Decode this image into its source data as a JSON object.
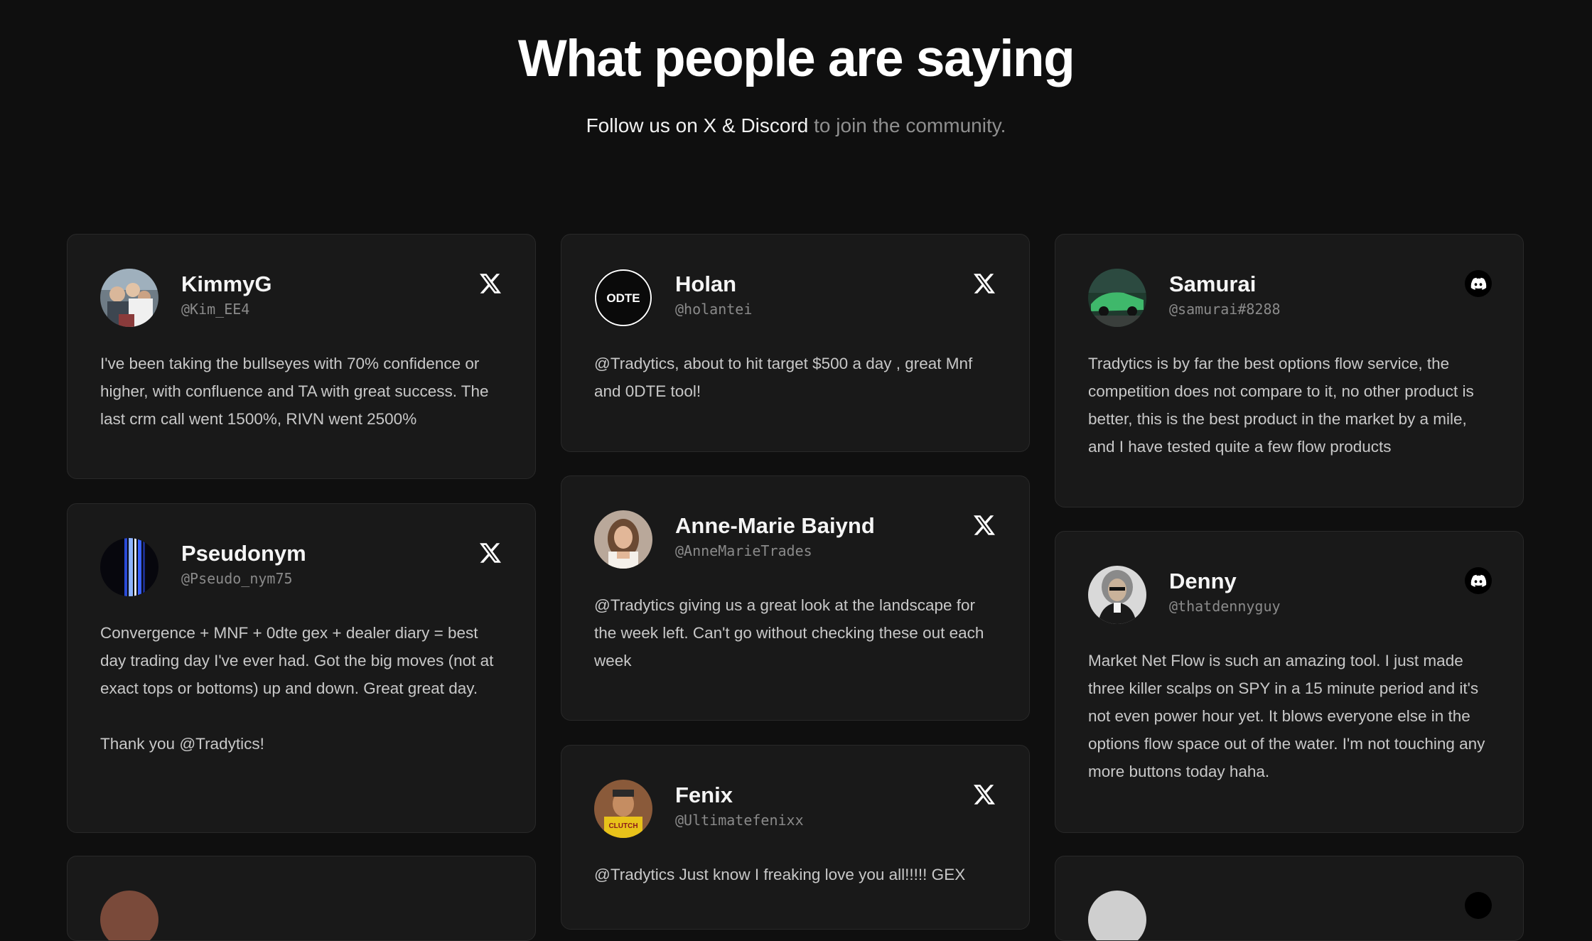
{
  "header": {
    "title": "What people are saying",
    "subtitle_strong": "Follow us on X & Discord",
    "subtitle_muted": " to join the community."
  },
  "colors": {
    "background": "#0f0f0f",
    "card_background": "#191919",
    "card_border": "#292929",
    "handle_text": "#8a8a8a",
    "body_text": "#c8c8c8",
    "muted_text": "#8f8f8f"
  },
  "testimonials": [
    {
      "name": "KimmyG",
      "handle": "@Kim_EE4",
      "platform": "x-icon",
      "text": "I've been taking the bullseyes with 70% confidence or higher, with confluence and TA with great success. The last crm call went 1500%, RIVN went 2500%"
    },
    {
      "name": "Holan",
      "handle": "@holantei",
      "platform": "x-icon",
      "avatar_text": "ODTE",
      "text": "@Tradytics, about to hit target $500 a day , great Mnf and 0DTE tool!"
    },
    {
      "name": "Samurai",
      "handle": "@samurai#8288",
      "platform": "discord-icon",
      "text": "Tradytics is by far the best options flow service, the competition does not compare to it, no other product is better, this is the best product in the market by a mile, and I have tested quite a few flow products"
    },
    {
      "name": "Pseudonym",
      "handle": "@Pseudo_nym75",
      "platform": "x-icon",
      "text": "Convergence + MNF + 0dte gex + dealer diary = best day trading day I've ever had. Got the big moves (not at exact tops or bottoms) up and down. Great great day.\n\nThank you @Tradytics!"
    },
    {
      "name": "Anne-Marie Baiynd",
      "handle": "@AnneMarieTrades",
      "platform": "x-icon",
      "text": "@Tradytics giving us a great look at the landscape for the week left. Can't go without checking these out each week"
    },
    {
      "name": "Denny",
      "handle": "@thatdennyguy",
      "platform": "discord-icon",
      "text": "Market Net Flow is such an amazing tool. I just made three killer scalps on SPY in a 15 minute period and it's not even power hour yet. It blows everyone else in the options flow space out of the water. I'm not touching any more buttons today haha."
    },
    {
      "name": "Fenix",
      "handle": "@Ultimatefenixx",
      "platform": "x-icon",
      "avatar_text": "CLUTCH",
      "text": "@Tradytics Just know I freaking love you all!!!!! GEX"
    }
  ]
}
